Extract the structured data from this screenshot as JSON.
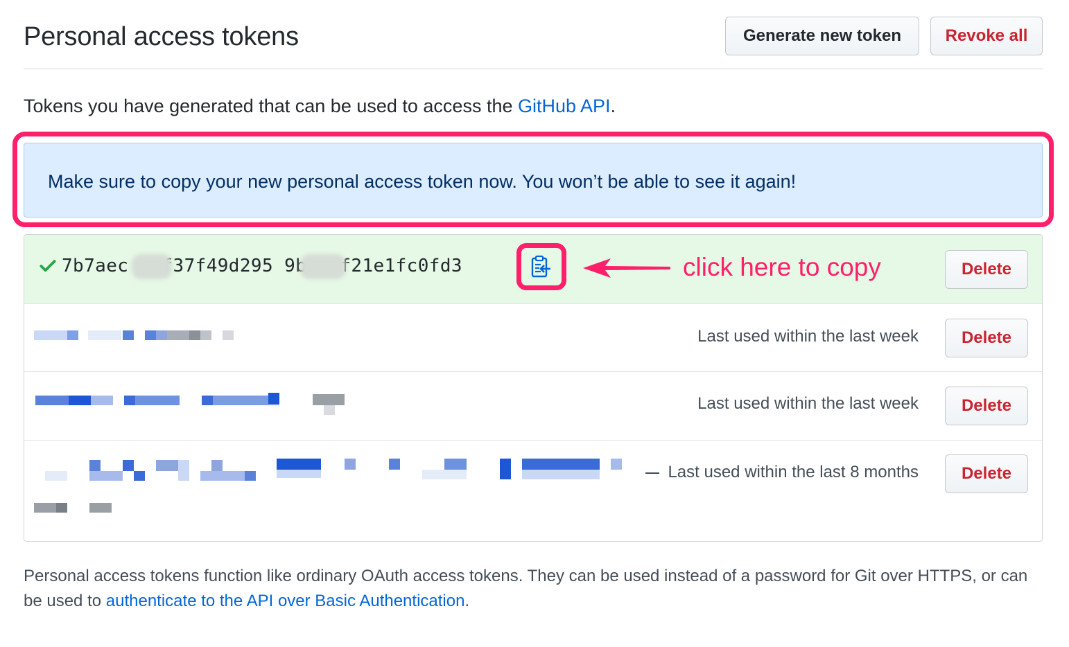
{
  "header": {
    "title": "Personal access tokens",
    "generate_label": "Generate new token",
    "revoke_label": "Revoke all"
  },
  "intro": {
    "text": "Tokens you have generated that can be used to access the ",
    "link": "GitHub API",
    "suffix": "."
  },
  "flash": {
    "message": "Make sure to copy your new personal access token now. You won’t be able to see it again!"
  },
  "tokens": {
    "new_token": {
      "value": "7b7aec    6df37f49d295    9b9e2f21e1fc0fd3",
      "delete_label": "Delete"
    },
    "rows": [
      {
        "last_used": "Last used within the last week",
        "delete_label": "Delete"
      },
      {
        "last_used": "Last used within the last week",
        "delete_label": "Delete"
      },
      {
        "last_used": "Last used within the last 8 months",
        "delete_label": "Delete"
      }
    ]
  },
  "annotation": {
    "text": "click here to copy",
    "color": "#ff1f6a"
  },
  "footer": {
    "text": "Personal access tokens function like ordinary OAuth access tokens. They can be used instead of a password for Git over HTTPS, or can be used to ",
    "link": "authenticate to the API over Basic Authentication",
    "suffix": "."
  },
  "colors": {
    "link": "#0366d6",
    "danger": "#cb2431",
    "flash_bg": "#dbedff",
    "success_bg": "#e6f8e6",
    "success_check": "#28a745"
  }
}
